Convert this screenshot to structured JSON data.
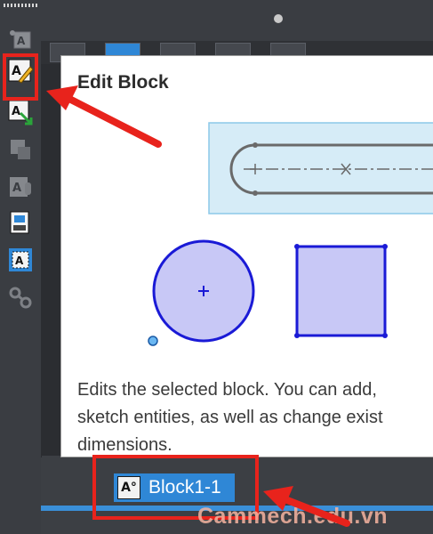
{
  "popup": {
    "title": "Edit Block",
    "description_lines": [
      "Edits the selected block. You can add,",
      "sketch entities, as well as change exist",
      "dimensions."
    ]
  },
  "tree": {
    "block_icon_text": "A°",
    "block_label": "Block1-1"
  },
  "toolbar": {
    "buttons": [
      {
        "name": "insert-note-icon"
      },
      {
        "name": "edit-block-icon"
      },
      {
        "name": "save-block-icon"
      },
      {
        "name": "explode-block-icon"
      },
      {
        "name": "rebuild-block-icon"
      },
      {
        "name": "save-block-file-icon"
      },
      {
        "name": "block-note-icon"
      },
      {
        "name": "link-block-icon"
      }
    ]
  },
  "watermark": "Cammech.edu.vn",
  "colors": {
    "highlight": "#e8231c",
    "selection": "#2f87d6",
    "sketch_fill": "#c8c8f6",
    "sketch_stroke": "#1a1ad6"
  }
}
